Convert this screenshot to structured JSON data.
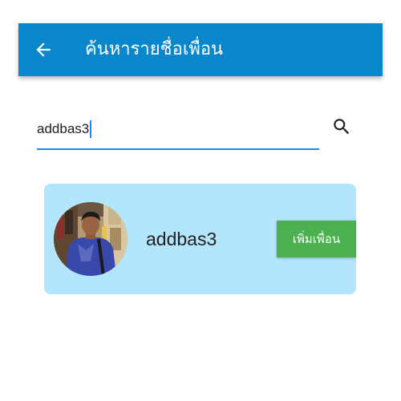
{
  "app_bar": {
    "title": "ค้นหารายชื่อเพื่อน",
    "back_icon": "arrow-back-icon",
    "color": "#0a87ca"
  },
  "search": {
    "value": "addbas3",
    "search_icon": "search-icon",
    "underline_color": "#1e88e5"
  },
  "result": {
    "username": "addbas3",
    "add_friend_label": "เพิ่มเพื่อน",
    "card_color": "#b3e5fc",
    "button_color": "#4caf50"
  }
}
